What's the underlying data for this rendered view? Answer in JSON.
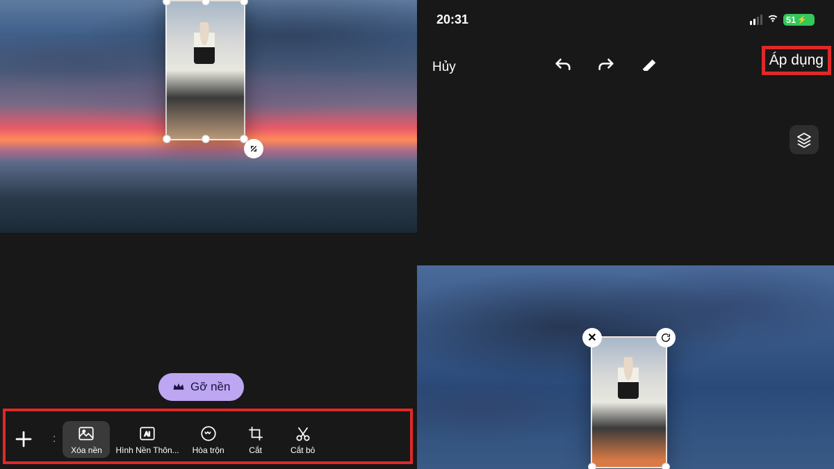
{
  "status": {
    "time": "20:31",
    "battery": "51"
  },
  "topbar": {
    "cancel": "Hủy",
    "apply": "Áp dụng"
  },
  "pill": {
    "label": "Gỡ nền"
  },
  "toolbar": {
    "items": [
      {
        "name": "xoa-nen",
        "label": "Xóa nền"
      },
      {
        "name": "hinh-nen",
        "label": "Hình Nền Thôn..."
      },
      {
        "name": "hoa-tron",
        "label": "Hòa trộn"
      },
      {
        "name": "cat",
        "label": "Cắt"
      },
      {
        "name": "cat-bo",
        "label": "Cắt bỏ"
      }
    ]
  },
  "icons": {
    "add": "add-icon",
    "undo": "undo-icon",
    "redo": "redo-icon",
    "eraser": "eraser-icon",
    "layers": "layers-icon",
    "crown": "crown-icon",
    "resize": "resize-icon",
    "signal": "signal-icon",
    "wifi": "wifi-icon"
  },
  "colors": {
    "highlight": "#e02828",
    "pill_bg": "#bda6f2",
    "battery_green": "#34c759"
  }
}
